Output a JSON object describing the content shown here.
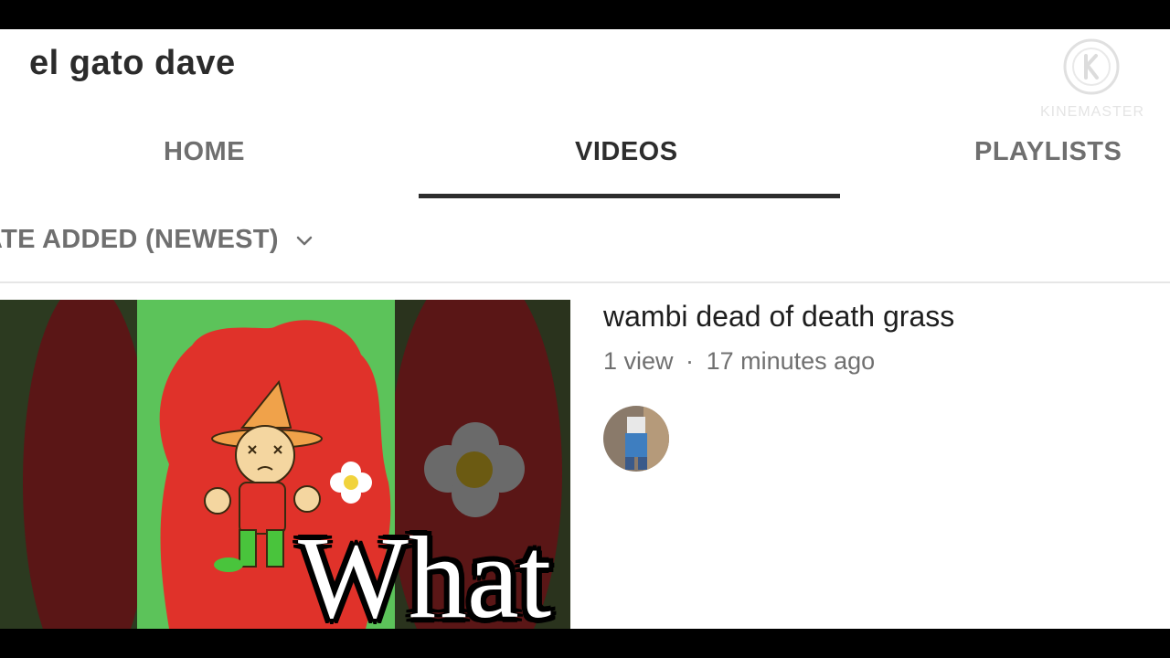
{
  "channel": {
    "name": "el gato dave"
  },
  "watermark": {
    "brand": "KINEMASTER",
    "logo_letter": "K"
  },
  "tabs": [
    {
      "label": "HOME",
      "active": false
    },
    {
      "label": "VIDEOS",
      "active": true
    },
    {
      "label": "PLAYLISTS",
      "active": false
    }
  ],
  "sort": {
    "label": "ATE ADDED (NEWEST)",
    "icon": "chevron-down-icon"
  },
  "video": {
    "title": "wambi dead of death grass",
    "views": "1 view",
    "separator": "·",
    "age": "17 minutes ago"
  },
  "caption": {
    "text": "What"
  },
  "colors": {
    "accent": "#2d2d2d",
    "inactive_text": "#6f6f6f",
    "thumb_red": "#e0322a",
    "thumb_green": "#5cc35a"
  }
}
